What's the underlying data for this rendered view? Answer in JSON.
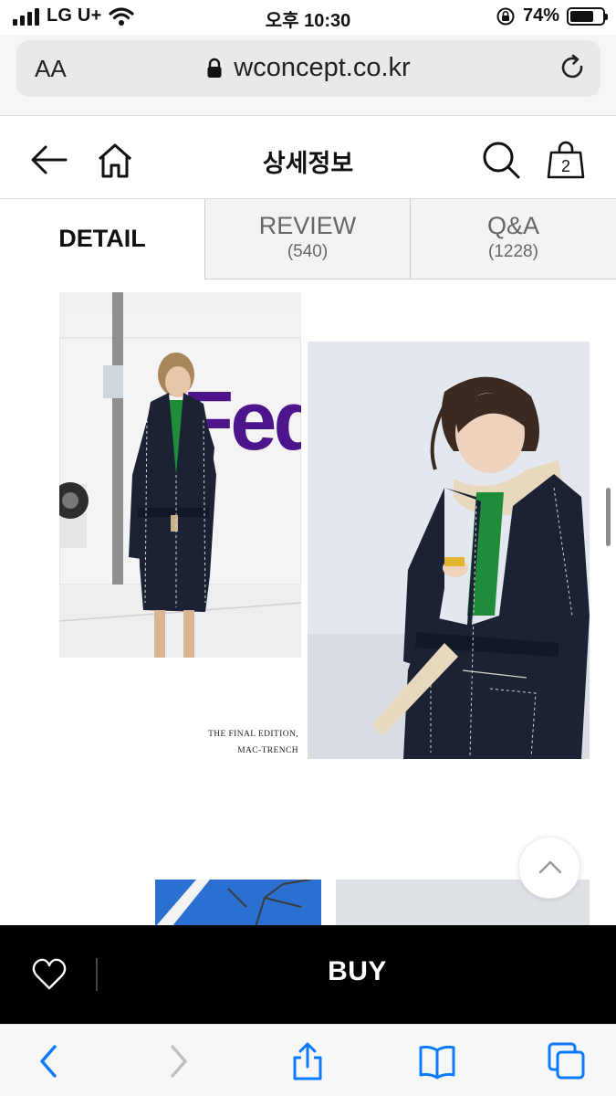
{
  "status_bar": {
    "carrier": "LG U+",
    "time": "오후 10:30",
    "battery_percent": "74%",
    "battery_level": 0.74,
    "icons": [
      "signal-icon",
      "wifi-icon",
      "orientation-lock-icon",
      "battery-icon"
    ]
  },
  "browser": {
    "text_size_label": "AA",
    "url": "wconcept.co.kr",
    "icons": [
      "lock-icon",
      "reload-icon"
    ]
  },
  "nav": {
    "title": "상세정보",
    "cart_count": "2",
    "icons": [
      "back-arrow-icon",
      "home-icon",
      "search-icon",
      "shopping-bag-icon"
    ]
  },
  "tabs": [
    {
      "label": "DETAIL",
      "active": true
    },
    {
      "label": "REVIEW",
      "count": "(540)",
      "active": false
    },
    {
      "label": "Q&A",
      "count": "(1228)",
      "active": false
    }
  ],
  "content": {
    "caption_line1": "THE FINAL EDITION,",
    "caption_line2": "MAC-TRENCH",
    "sign_text": "Fed"
  },
  "buy_bar": {
    "buy_label": "BUY",
    "icons": [
      "heart-icon"
    ]
  },
  "toolbar": {
    "icons": [
      "back-icon",
      "forward-icon",
      "share-icon",
      "bookmarks-icon",
      "tabs-icon"
    ]
  },
  "colors": {
    "brand_black": "#000000",
    "fedex_purple": "#4d148c",
    "coat_navy": "#1a2233",
    "sweater_green": "#1f8c3a",
    "ios_blue": "#0a7aff"
  }
}
